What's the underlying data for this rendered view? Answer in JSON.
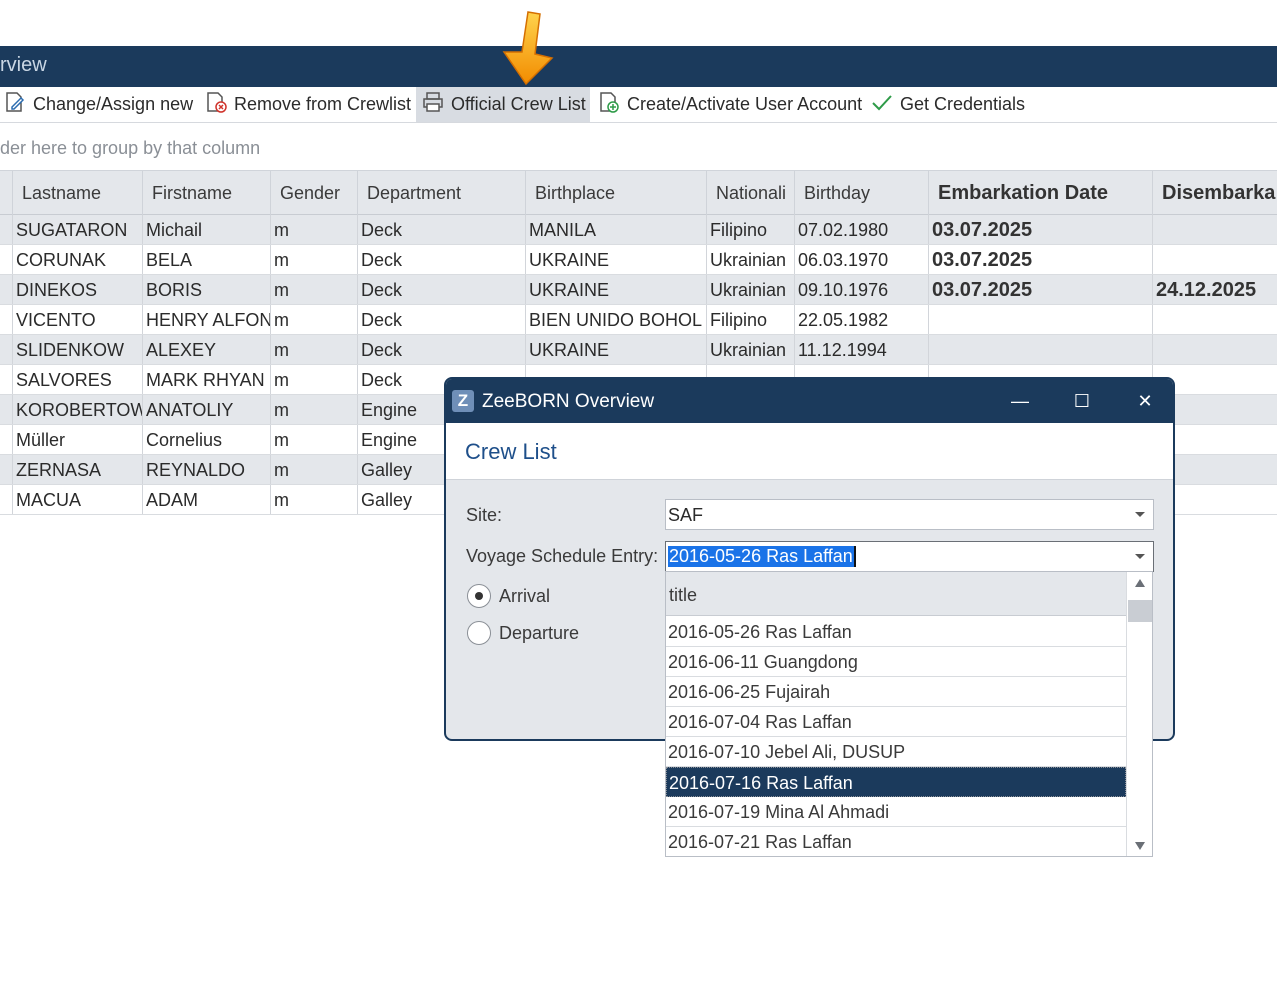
{
  "window": {
    "title_fragment": "rview"
  },
  "toolbar": {
    "change_assign": "Change/Assign new",
    "remove_crewlist": "Remove from Crewlist",
    "official_crew_list": "Official Crew List",
    "create_user": "Create/Activate User Account",
    "get_credentials": "Get Credentials"
  },
  "groupbar": {
    "hint": "der here to group by that column"
  },
  "grid": {
    "headers": [
      "Lastname",
      "Firstname",
      "Gender",
      "Department",
      "Birthplace",
      "Nationali",
      "Birthday",
      "Embarkation Date",
      "Disembarka"
    ],
    "rows": [
      [
        "SUGATARON",
        "Michail",
        "m",
        "Deck",
        "MANILA",
        "Filipino",
        "07.02.1980",
        "03.07.2025",
        ""
      ],
      [
        "CORUNAK",
        "BELA",
        "m",
        "Deck",
        "UKRAINE",
        "Ukrainian",
        "06.03.1970",
        "03.07.2025",
        ""
      ],
      [
        "DINEKOS",
        "BORIS",
        "m",
        "Deck",
        "UKRAINE",
        "Ukrainian",
        "09.10.1976",
        "03.07.2025",
        "24.12.2025"
      ],
      [
        "VICENTO",
        "HENRY ALFONS",
        "m",
        "Deck",
        "BIEN UNIDO BOHOL",
        "Filipino",
        "22.05.1982",
        "",
        ""
      ],
      [
        "SLIDENKOW",
        "ALEXEY",
        "m",
        "Deck",
        "UKRAINE",
        "Ukrainian",
        "11.12.1994",
        "",
        ""
      ],
      [
        "SALVORES",
        "MARK RHYAN",
        "m",
        "Deck",
        "",
        "",
        "",
        "",
        ""
      ],
      [
        "KOROBERTOW",
        "ANATOLIY",
        "m",
        "Engine",
        "",
        "",
        "",
        "",
        ""
      ],
      [
        "Müller",
        "Cornelius",
        "m",
        "Engine",
        "",
        "",
        "",
        "",
        ""
      ],
      [
        "ZERNASA",
        "REYNALDO",
        "m",
        "Galley",
        "",
        "",
        "",
        "",
        ""
      ],
      [
        "MACUA",
        "ADAM",
        "m",
        "Galley",
        "",
        "",
        "",
        "",
        ""
      ]
    ]
  },
  "dialog": {
    "app_title": "ZeeBORN Overview",
    "logo_letter": "Z",
    "minimize": "—",
    "maximize": "☐",
    "close": "✕",
    "header": "Crew List",
    "site_label": "Site:",
    "site_value": "SAF",
    "voyage_label": "Voyage Schedule Entry:",
    "voyage_value": "2016-05-26 Ras Laffan",
    "arrival_label": "Arrival",
    "departure_label": "Departure",
    "arrival_selected": true
  },
  "dropdown": {
    "column_header": "title",
    "items": [
      "2016-05-26 Ras Laffan",
      "2016-06-11 Guangdong",
      "2016-06-25 Fujairah",
      "2016-07-04 Ras Laffan",
      "2016-07-10 Jebel Ali, DUSUP",
      "2016-07-16 Ras Laffan",
      "2016-07-19 Mina Al Ahmadi",
      "2016-07-21 Ras Laffan"
    ],
    "selected_index": 5
  },
  "colors": {
    "titlebar": "#1b3a5c",
    "accent_arrow": "#f28c00",
    "header_text": "#1e4f8a"
  }
}
